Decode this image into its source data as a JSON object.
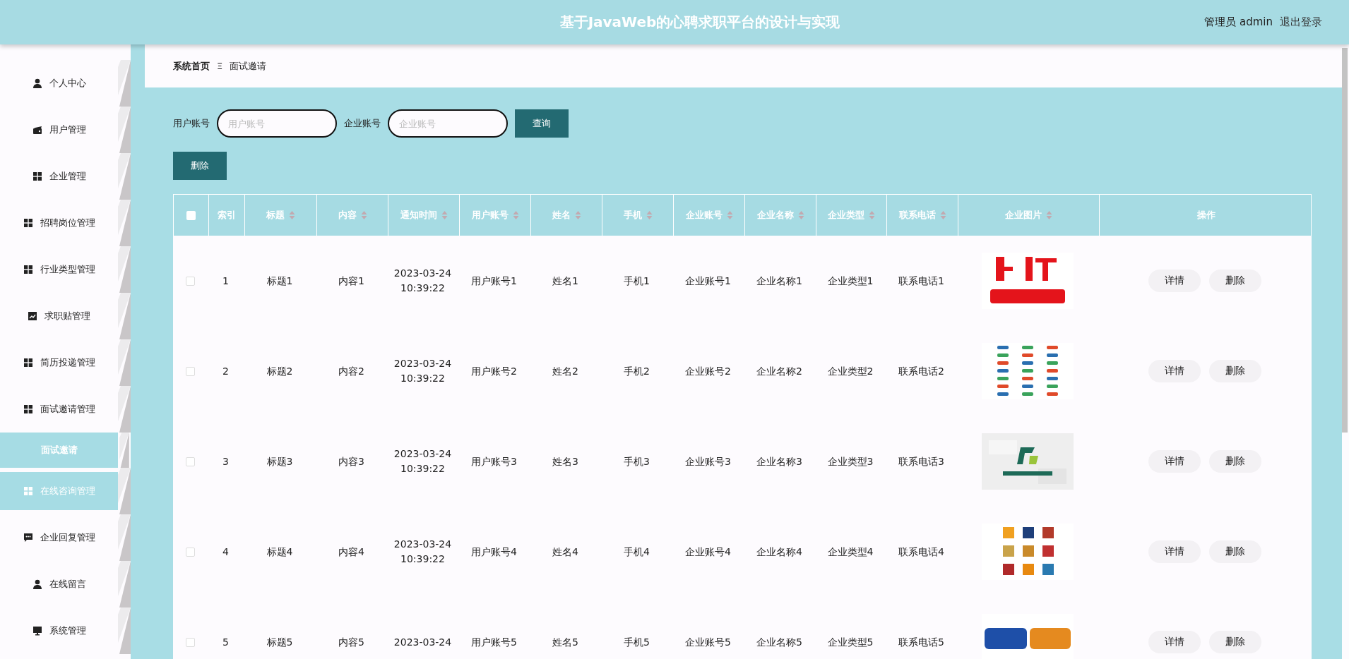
{
  "header": {
    "title": "基于JavaWeb的心聘求职平台的设计与实现",
    "user": "管理员 admin",
    "logout": "退出登录"
  },
  "sidebar": {
    "items": [
      {
        "label": "个人中心",
        "hovered": false
      },
      {
        "label": "用户管理",
        "hovered": false
      },
      {
        "label": "企业管理",
        "hovered": false
      },
      {
        "label": "招聘岗位管理",
        "hovered": false
      },
      {
        "label": "行业类型管理",
        "hovered": false
      },
      {
        "label": "求职贴管理",
        "hovered": false
      },
      {
        "label": "简历投递管理",
        "hovered": false
      },
      {
        "label": "面试邀请管理",
        "hovered": false,
        "expanded": true,
        "children": [
          {
            "label": "面试邀请",
            "selected": true
          }
        ]
      },
      {
        "label": "在线咨询管理",
        "hovered": true
      },
      {
        "label": "企业回复管理",
        "hovered": false
      },
      {
        "label": "在线留言",
        "hovered": false
      },
      {
        "label": "系统管理",
        "hovered": false
      }
    ]
  },
  "breadcrumb": {
    "home": "系统首页",
    "separator": "Ξ",
    "current": "面试邀请"
  },
  "search": {
    "fields": [
      {
        "label": "用户账号",
        "placeholder": "用户账号"
      },
      {
        "label": "企业账号",
        "placeholder": "企业账号"
      }
    ],
    "button": "查询"
  },
  "delete_button": "删除",
  "table": {
    "select_all": {
      "checked": false
    },
    "columns": [
      {
        "label": "索引",
        "sortable": false
      },
      {
        "label": "标题",
        "sortable": true
      },
      {
        "label": "内容",
        "sortable": true
      },
      {
        "label": "通知时间",
        "sortable": true
      },
      {
        "label": "用户账号",
        "sortable": true
      },
      {
        "label": "姓名",
        "sortable": true
      },
      {
        "label": "手机",
        "sortable": true
      },
      {
        "label": "企业账号",
        "sortable": true
      },
      {
        "label": "企业名称",
        "sortable": true
      },
      {
        "label": "企业类型",
        "sortable": true
      },
      {
        "label": "联系电话",
        "sortable": true
      },
      {
        "label": "企业图片",
        "sortable": true
      },
      {
        "label": "操作",
        "sortable": false
      }
    ],
    "rows": [
      {
        "checked": false,
        "cells": [
          "1",
          "标题1",
          "内容1",
          "2023-03-24 10:39:22",
          "用户账号1",
          "姓名1",
          "手机1",
          "企业账号1",
          "企业名称1",
          "企业类型1",
          "联系电话1"
        ],
        "image": {
          "kind": "picture"
        },
        "actions": [
          "详情",
          "删除"
        ]
      },
      {
        "checked": false,
        "cells": [
          "2",
          "标题2",
          "内容2",
          "2023-03-24 10:39:22",
          "用户账号2",
          "姓名2",
          "手机2",
          "企业账号2",
          "企业名称2",
          "企业类型2",
          "联系电话2"
        ],
        "image": {
          "kind": "picture"
        },
        "actions": [
          "详情",
          "删除"
        ]
      },
      {
        "checked": false,
        "cells": [
          "3",
          "标题3",
          "内容3",
          "2023-03-24 10:39:22",
          "用户账号3",
          "姓名3",
          "手机3",
          "企业账号3",
          "企业名称3",
          "企业类型3",
          "联系电话3"
        ],
        "image": {
          "kind": "picture"
        },
        "actions": [
          "详情",
          "删除"
        ]
      },
      {
        "checked": false,
        "cells": [
          "4",
          "标题4",
          "内容4",
          "2023-03-24 10:39:22",
          "用户账号4",
          "姓名4",
          "手机4",
          "企业账号4",
          "企业名称4",
          "企业类型4",
          "联系电话4"
        ],
        "image": {
          "kind": "picture"
        },
        "actions": [
          "详情",
          "删除"
        ]
      },
      {
        "checked": false,
        "cells": [
          "5",
          "标题5",
          "内容5",
          "2023-03-24",
          "用户账号5",
          "姓名5",
          "手机5",
          "企业账号5",
          "企业名称5",
          "企业类型5",
          "联系电话5"
        ],
        "image": {
          "kind": "picture"
        },
        "actions": [
          "详情",
          "删除"
        ]
      }
    ]
  }
}
